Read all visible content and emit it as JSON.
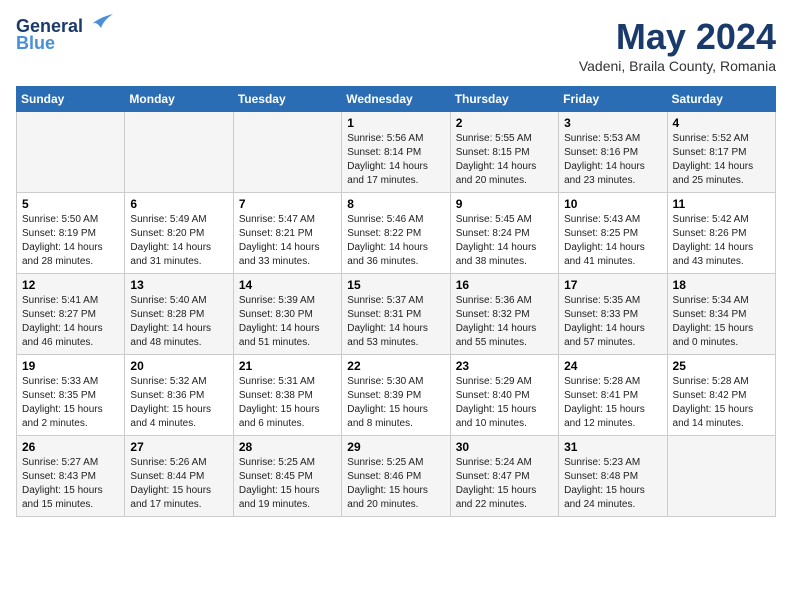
{
  "header": {
    "logo_line1": "General",
    "logo_line2": "Blue",
    "month": "May 2024",
    "location": "Vadeni, Braila County, Romania"
  },
  "days_of_week": [
    "Sunday",
    "Monday",
    "Tuesday",
    "Wednesday",
    "Thursday",
    "Friday",
    "Saturday"
  ],
  "weeks": [
    [
      {
        "day": "",
        "info": ""
      },
      {
        "day": "",
        "info": ""
      },
      {
        "day": "",
        "info": ""
      },
      {
        "day": "1",
        "info": "Sunrise: 5:56 AM\nSunset: 8:14 PM\nDaylight: 14 hours\nand 17 minutes."
      },
      {
        "day": "2",
        "info": "Sunrise: 5:55 AM\nSunset: 8:15 PM\nDaylight: 14 hours\nand 20 minutes."
      },
      {
        "day": "3",
        "info": "Sunrise: 5:53 AM\nSunset: 8:16 PM\nDaylight: 14 hours\nand 23 minutes."
      },
      {
        "day": "4",
        "info": "Sunrise: 5:52 AM\nSunset: 8:17 PM\nDaylight: 14 hours\nand 25 minutes."
      }
    ],
    [
      {
        "day": "5",
        "info": "Sunrise: 5:50 AM\nSunset: 8:19 PM\nDaylight: 14 hours\nand 28 minutes."
      },
      {
        "day": "6",
        "info": "Sunrise: 5:49 AM\nSunset: 8:20 PM\nDaylight: 14 hours\nand 31 minutes."
      },
      {
        "day": "7",
        "info": "Sunrise: 5:47 AM\nSunset: 8:21 PM\nDaylight: 14 hours\nand 33 minutes."
      },
      {
        "day": "8",
        "info": "Sunrise: 5:46 AM\nSunset: 8:22 PM\nDaylight: 14 hours\nand 36 minutes."
      },
      {
        "day": "9",
        "info": "Sunrise: 5:45 AM\nSunset: 8:24 PM\nDaylight: 14 hours\nand 38 minutes."
      },
      {
        "day": "10",
        "info": "Sunrise: 5:43 AM\nSunset: 8:25 PM\nDaylight: 14 hours\nand 41 minutes."
      },
      {
        "day": "11",
        "info": "Sunrise: 5:42 AM\nSunset: 8:26 PM\nDaylight: 14 hours\nand 43 minutes."
      }
    ],
    [
      {
        "day": "12",
        "info": "Sunrise: 5:41 AM\nSunset: 8:27 PM\nDaylight: 14 hours\nand 46 minutes."
      },
      {
        "day": "13",
        "info": "Sunrise: 5:40 AM\nSunset: 8:28 PM\nDaylight: 14 hours\nand 48 minutes."
      },
      {
        "day": "14",
        "info": "Sunrise: 5:39 AM\nSunset: 8:30 PM\nDaylight: 14 hours\nand 51 minutes."
      },
      {
        "day": "15",
        "info": "Sunrise: 5:37 AM\nSunset: 8:31 PM\nDaylight: 14 hours\nand 53 minutes."
      },
      {
        "day": "16",
        "info": "Sunrise: 5:36 AM\nSunset: 8:32 PM\nDaylight: 14 hours\nand 55 minutes."
      },
      {
        "day": "17",
        "info": "Sunrise: 5:35 AM\nSunset: 8:33 PM\nDaylight: 14 hours\nand 57 minutes."
      },
      {
        "day": "18",
        "info": "Sunrise: 5:34 AM\nSunset: 8:34 PM\nDaylight: 15 hours\nand 0 minutes."
      }
    ],
    [
      {
        "day": "19",
        "info": "Sunrise: 5:33 AM\nSunset: 8:35 PM\nDaylight: 15 hours\nand 2 minutes."
      },
      {
        "day": "20",
        "info": "Sunrise: 5:32 AM\nSunset: 8:36 PM\nDaylight: 15 hours\nand 4 minutes."
      },
      {
        "day": "21",
        "info": "Sunrise: 5:31 AM\nSunset: 8:38 PM\nDaylight: 15 hours\nand 6 minutes."
      },
      {
        "day": "22",
        "info": "Sunrise: 5:30 AM\nSunset: 8:39 PM\nDaylight: 15 hours\nand 8 minutes."
      },
      {
        "day": "23",
        "info": "Sunrise: 5:29 AM\nSunset: 8:40 PM\nDaylight: 15 hours\nand 10 minutes."
      },
      {
        "day": "24",
        "info": "Sunrise: 5:28 AM\nSunset: 8:41 PM\nDaylight: 15 hours\nand 12 minutes."
      },
      {
        "day": "25",
        "info": "Sunrise: 5:28 AM\nSunset: 8:42 PM\nDaylight: 15 hours\nand 14 minutes."
      }
    ],
    [
      {
        "day": "26",
        "info": "Sunrise: 5:27 AM\nSunset: 8:43 PM\nDaylight: 15 hours\nand 15 minutes."
      },
      {
        "day": "27",
        "info": "Sunrise: 5:26 AM\nSunset: 8:44 PM\nDaylight: 15 hours\nand 17 minutes."
      },
      {
        "day": "28",
        "info": "Sunrise: 5:25 AM\nSunset: 8:45 PM\nDaylight: 15 hours\nand 19 minutes."
      },
      {
        "day": "29",
        "info": "Sunrise: 5:25 AM\nSunset: 8:46 PM\nDaylight: 15 hours\nand 20 minutes."
      },
      {
        "day": "30",
        "info": "Sunrise: 5:24 AM\nSunset: 8:47 PM\nDaylight: 15 hours\nand 22 minutes."
      },
      {
        "day": "31",
        "info": "Sunrise: 5:23 AM\nSunset: 8:48 PM\nDaylight: 15 hours\nand 24 minutes."
      },
      {
        "day": "",
        "info": ""
      }
    ]
  ]
}
